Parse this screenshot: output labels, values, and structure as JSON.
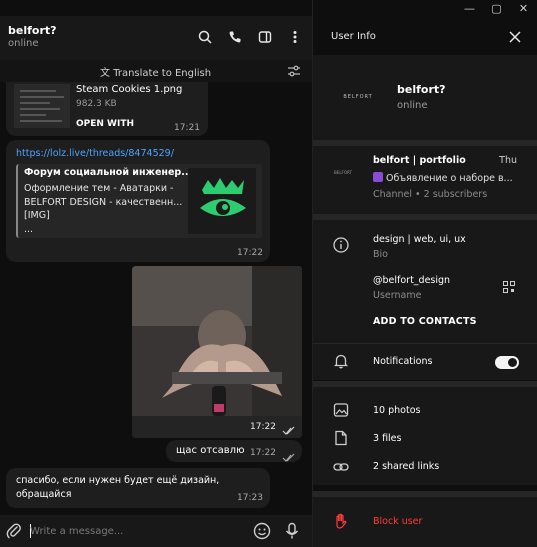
{
  "chat": {
    "title": "belfort?",
    "status": "online",
    "translate_label": "Translate to English",
    "messages": {
      "file": {
        "name": "Steam Cookies 1.png",
        "size": "982.3 KB",
        "action": "OPEN WITH",
        "time": "17:21"
      },
      "link": {
        "url": "https://lolz.live/threads/8474529/",
        "preview_title": "Форум социальной инженер...",
        "preview_lines": [
          "Оформление тем - Аватарки -",
          "BELFORT DESIGN - качественн...",
          "[IMG]",
          "..."
        ],
        "time": "17:22"
      },
      "photo": {
        "time": "17:22"
      },
      "reply_out": {
        "text": "щас отсавлю",
        "time": "17:22"
      },
      "reply_in": {
        "text": "спасибо, если нужен будет ещё дизайн, обращайся",
        "time": "17:23"
      }
    },
    "composer": {
      "placeholder": "Write a message..."
    }
  },
  "info": {
    "title": "User Info",
    "user": {
      "name": "belfort?",
      "status": "online",
      "logo_text": "BELFORT"
    },
    "channel": {
      "name": "belfort | portfolio",
      "day": "Thu",
      "last_message": "Объявление о наборе в...",
      "subtitle": "Channel • 2 subscribers",
      "thumb_text": "BELFORT"
    },
    "bio": {
      "value": "design | web, ui, ux",
      "label": "Bio"
    },
    "username": {
      "value": "@belfort_design",
      "label": "Username"
    },
    "add_contact": "ADD TO CONTACTS",
    "notifications": {
      "label": "Notifications",
      "enabled": true
    },
    "media": {
      "photos": "10 photos",
      "files": "3 files",
      "links": "2 shared links"
    },
    "block": "Block user"
  },
  "colors": {
    "accent_link": "#4da3ff",
    "danger": "#ff3b3b",
    "brand_green": "#2ecc71"
  }
}
